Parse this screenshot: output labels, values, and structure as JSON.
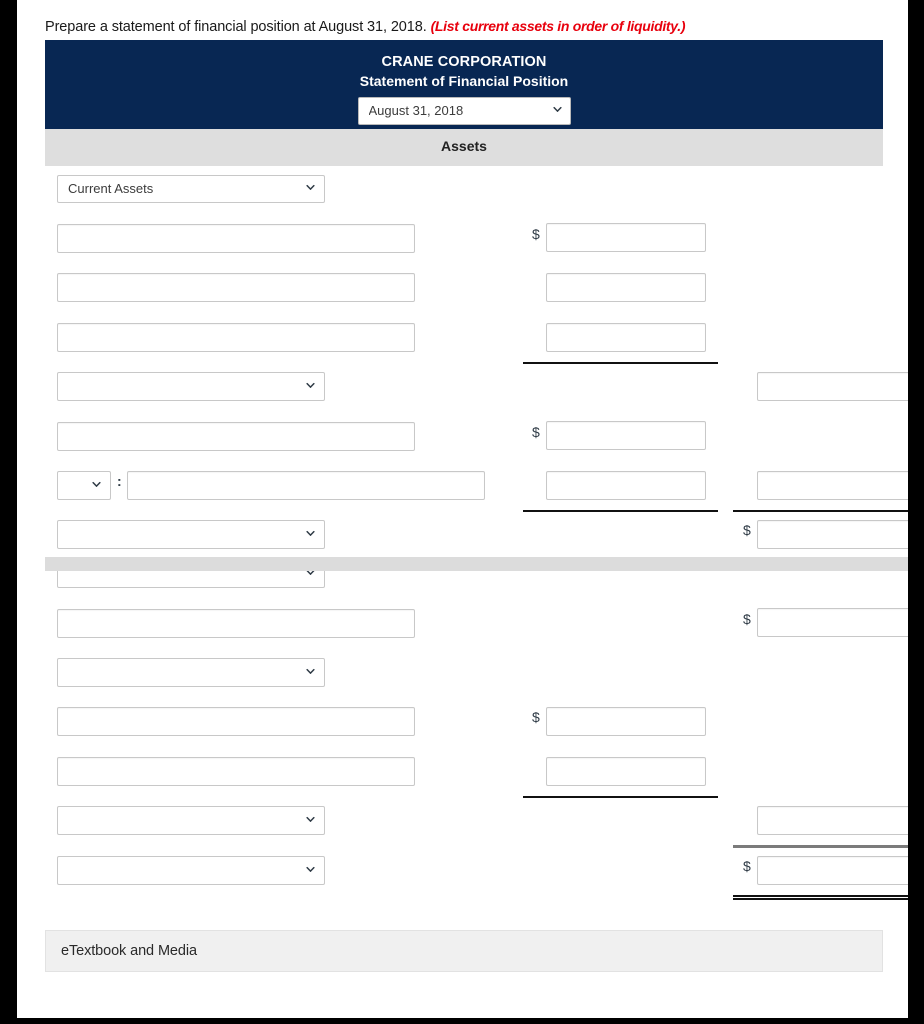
{
  "prompt": {
    "text": "Prepare a statement of financial position at August 31, 2018. ",
    "note": "(List current assets in order of liquidity.)"
  },
  "statement": {
    "company_name": "CRANE CORPORATION",
    "title": "Statement of Financial Position",
    "date_select": {
      "value": "August 31, 2018",
      "options": [
        "August 31, 2018"
      ]
    },
    "section_band": "Assets"
  },
  "category_selects": {
    "current_assets": {
      "value": "Current Assets",
      "options": [
        "Current Assets"
      ]
    },
    "blank": {
      "value": "",
      "options": [
        ""
      ]
    }
  },
  "rows": [
    {
      "id": "row-1",
      "label_value": "",
      "label_type": "text",
      "amount_col": "mid",
      "dollar": true
    },
    {
      "id": "row-2",
      "label_value": "",
      "label_type": "text",
      "amount_col": "mid",
      "dollar": false
    },
    {
      "id": "row-3",
      "label_value": "",
      "label_type": "text",
      "amount_col": "mid",
      "dollar": false
    },
    {
      "id": "row-4",
      "label_value": "",
      "label_type": "select",
      "amount_col": "right",
      "dollar": false
    },
    {
      "id": "row-5",
      "label_value": "",
      "label_type": "text",
      "amount_col": "mid",
      "dollar": true
    },
    {
      "id": "row-6",
      "label_value": "",
      "label_type": "select-text",
      "amount_col": "both",
      "dollar": false
    },
    {
      "id": "row-7",
      "label_value": "",
      "label_type": "select",
      "amount_col": "right",
      "dollar": true
    },
    {
      "id": "row-8",
      "label_value": "",
      "label_type": "select",
      "amount_col": "none",
      "dollar": false
    },
    {
      "id": "row-9",
      "label_value": "",
      "label_type": "text",
      "amount_col": "right",
      "dollar": true
    },
    {
      "id": "row-10",
      "label_value": "",
      "label_type": "select",
      "amount_col": "none",
      "dollar": false
    },
    {
      "id": "row-11",
      "label_value": "",
      "label_type": "text",
      "amount_col": "mid",
      "dollar": true
    },
    {
      "id": "row-12",
      "label_value": "",
      "label_type": "text",
      "amount_col": "mid",
      "dollar": false
    },
    {
      "id": "row-13",
      "label_value": "",
      "label_type": "select",
      "amount_col": "right",
      "dollar": false
    },
    {
      "id": "row-14",
      "label_value": "",
      "label_type": "select",
      "amount_col": "right",
      "dollar": true
    }
  ],
  "footer": {
    "etextbook_label": "eTextbook and Media"
  },
  "colors": {
    "header_navy": "#082753",
    "band_gray": "#dedede",
    "note_red": "#e8000d",
    "field_border": "#c8c8c8",
    "page_white": "#ffffff",
    "frame_black": "#000000"
  }
}
